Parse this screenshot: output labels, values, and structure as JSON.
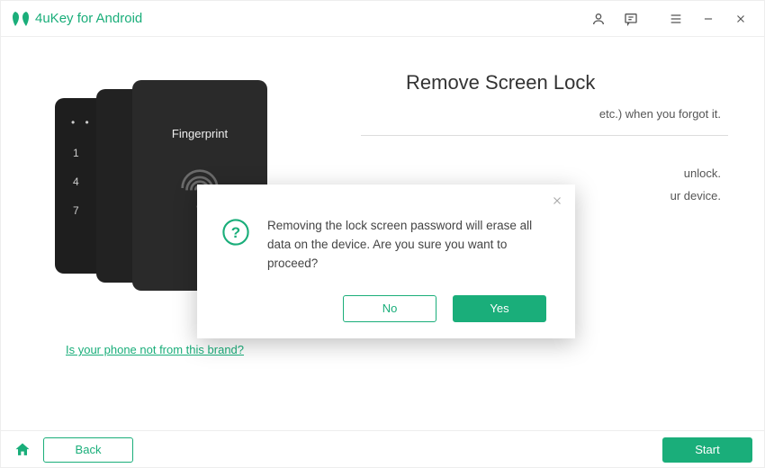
{
  "titlebar": {
    "app_name": "4uKey for Android"
  },
  "page": {
    "title": "Remove Screen Lock",
    "desc_tail": "etc.) when you forgot it.",
    "bullet_tail_1": "unlock.",
    "bullet_tail_2": "ur device."
  },
  "phone": {
    "fingerprint_label": "Fingerprint",
    "num1": "1",
    "num2": "4",
    "num3": "7"
  },
  "brand_link": "Is your phone not from this brand?",
  "modal": {
    "message": "Removing the lock screen password will erase all data on the device. Are you sure you want to proceed?",
    "no": "No",
    "yes": "Yes"
  },
  "footer": {
    "back": "Back",
    "start": "Start"
  }
}
